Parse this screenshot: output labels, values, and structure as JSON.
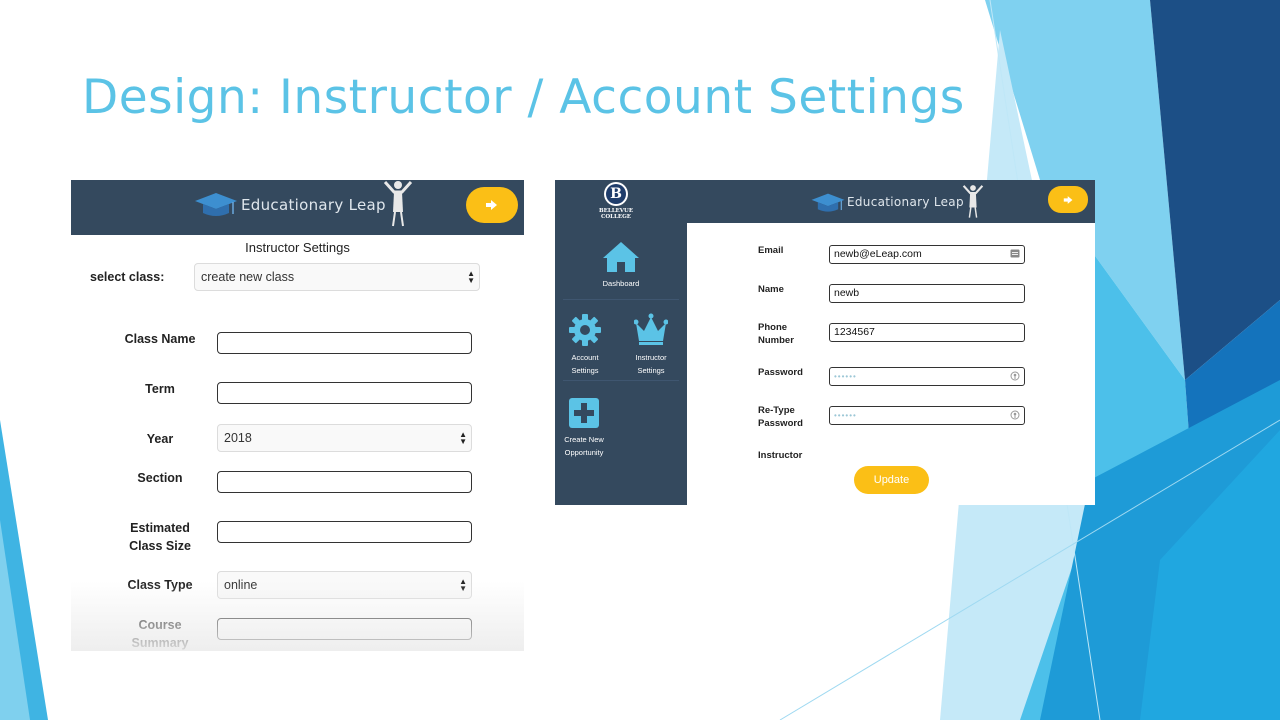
{
  "slide": {
    "title": "Design: Instructor / Account Settings"
  },
  "colors": {
    "title": "#5bc3e6",
    "nav_bg": "#34495e",
    "accent": "#fbbf16",
    "deco_blue": "#1e9bd7"
  },
  "app": {
    "logo_text": "Educationary Leap",
    "exit_icon": "exit-icon"
  },
  "instructor_settings": {
    "heading": "Instructor Settings",
    "select_class_label": "select class:",
    "select_class_value": "create new class",
    "fields": {
      "class_name": {
        "label": "Class Name",
        "value": ""
      },
      "term": {
        "label": "Term",
        "value": ""
      },
      "year": {
        "label": "Year",
        "value": "2018"
      },
      "section": {
        "label": "Section",
        "value": ""
      },
      "class_size": {
        "label_line1": "Estimated",
        "label_line2": "Class Size",
        "value": ""
      },
      "class_type": {
        "label": "Class Type",
        "value": "online"
      },
      "course_summary": {
        "label_line1": "Course",
        "label_line2": "Summary",
        "value": ""
      }
    }
  },
  "account_settings": {
    "college_logo_letter": "B",
    "college_name": "BELLEVUE",
    "college_sub": "COLLEGE",
    "sidebar": {
      "dashboard": "Dashboard",
      "account_settings_line1": "Account",
      "account_settings_line2": "Settings",
      "instructor_settings_line1": "Instructor",
      "instructor_settings_line2": "Settings",
      "create_line1": "Create New",
      "create_line2": "Opportunity"
    },
    "form": {
      "email_label": "Email",
      "email_value": "newb@eLeap.com",
      "name_label": "Name",
      "name_value": "newb",
      "phone_label_line1": "Phone",
      "phone_label_line2": "Number",
      "phone_value": "1234567",
      "password_label": "Password",
      "password_value": "••••••",
      "retype_label_line1": "Re-Type",
      "retype_label_line2": "Password",
      "retype_value": "••••••",
      "instructor_label": "Instructor",
      "update_label": "Update"
    }
  }
}
